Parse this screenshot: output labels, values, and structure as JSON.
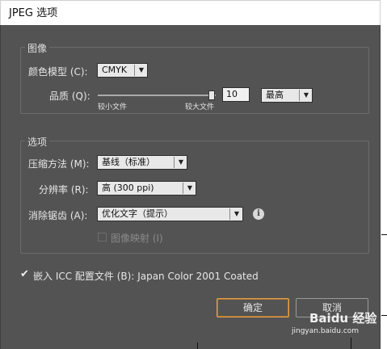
{
  "window": {
    "title": "JPEG 选项"
  },
  "image_group": {
    "legend": "图像",
    "color_model": {
      "label": "颜色模型 (C):",
      "value": "CMYK"
    },
    "quality": {
      "label": "品质 (Q):",
      "value": "10",
      "level": "最高",
      "min_label": "较小文件",
      "max_label": "较大文件",
      "slider_fraction": 1.0
    }
  },
  "options_group": {
    "legend": "选项",
    "compression": {
      "label": "压缩方法 (M):",
      "value": "基线（标准）"
    },
    "resolution": {
      "label": "分辨率 (R):",
      "value": "高 (300 ppi)"
    },
    "antialias": {
      "label": "消除锯齿 (A):",
      "value": "优化文字（提示）",
      "info_icon": "info-icon"
    },
    "image_map": {
      "label": "图像映射 (I)",
      "checked": false,
      "enabled": false
    }
  },
  "embed_icc": {
    "label": "嵌入 ICC 配置文件 (B): Japan Color 2001 Coated",
    "checked": true
  },
  "buttons": {
    "ok": "确定",
    "cancel": "取消"
  },
  "watermark": {
    "brand": "Baidu 经验",
    "url": "jingyan.baidu.com"
  }
}
